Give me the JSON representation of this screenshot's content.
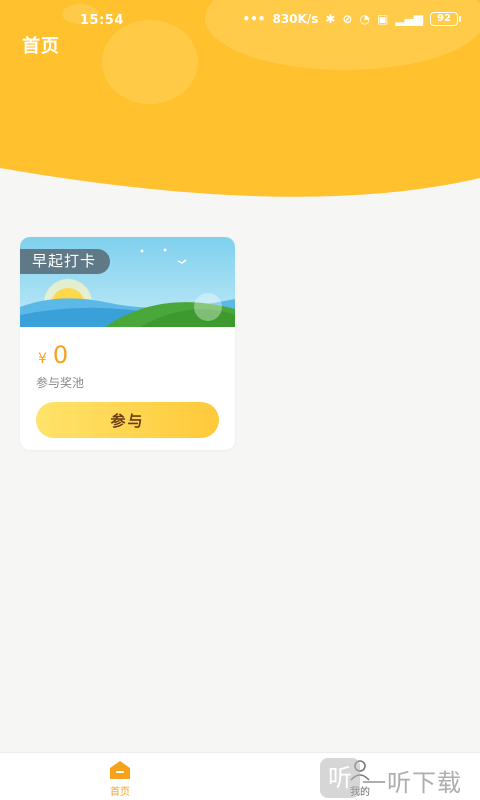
{
  "status_bar": {
    "time": "15:54",
    "network_speed": "830K/s",
    "battery": "92"
  },
  "header": {
    "title": "首页"
  },
  "card": {
    "tag": "早起打卡",
    "currency_symbol": "¥",
    "prize_value": "0",
    "prize_label": "参与奖池",
    "join_label": "参与"
  },
  "bottom_nav": {
    "items": [
      {
        "label": "首页",
        "icon": "home-icon",
        "active": true
      },
      {
        "label": "我的",
        "icon": "user-icon",
        "active": false
      }
    ]
  },
  "watermark": {
    "glyph": "听",
    "text": "一听下载"
  },
  "colors": {
    "header_yellow": "#ffc12d",
    "accent_orange": "#f7a21c",
    "button_start": "#ffe36a",
    "button_end": "#ffc93a",
    "tag_bg": "#5f7a86"
  }
}
